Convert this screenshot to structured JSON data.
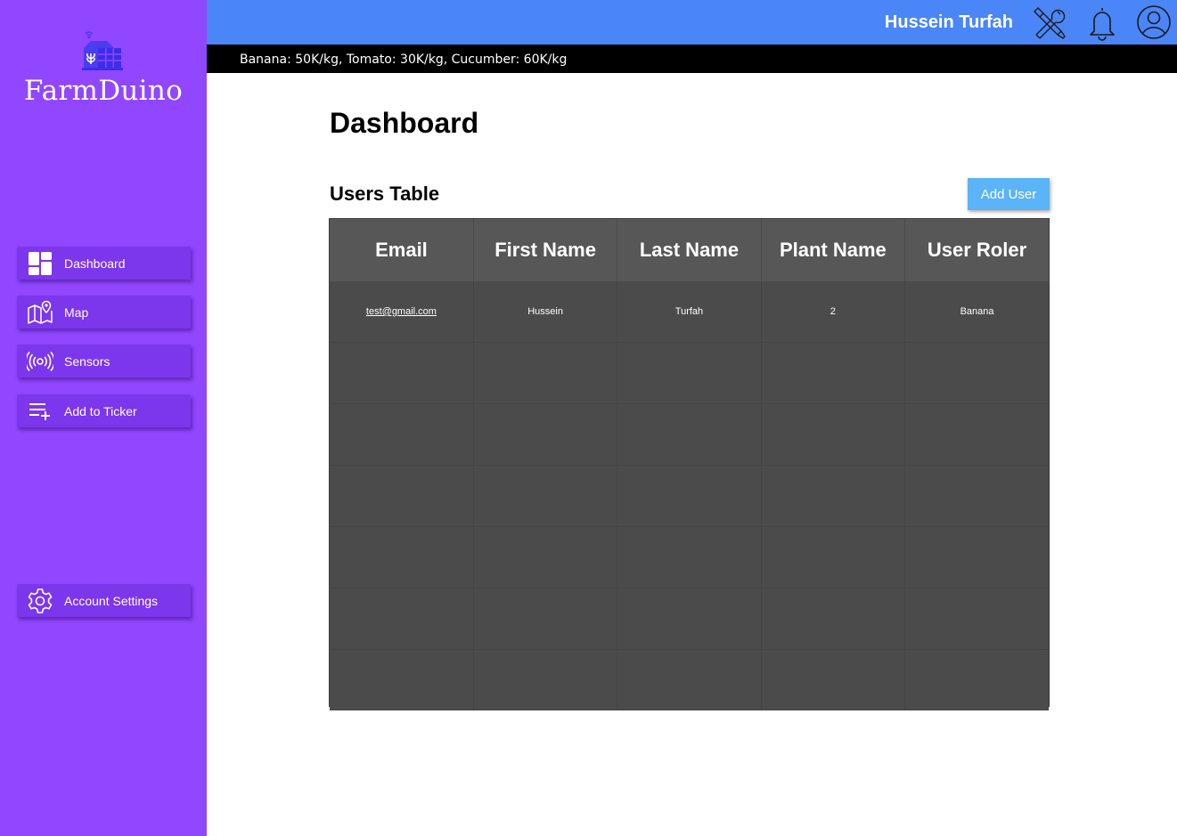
{
  "app": {
    "name": "FarmDuino"
  },
  "sidebar": {
    "items": [
      {
        "label": "Dashboard",
        "icon": "dashboard-icon"
      },
      {
        "label": "Map",
        "icon": "map-icon"
      },
      {
        "label": "Sensors",
        "icon": "sensor-icon"
      },
      {
        "label": "Add to Ticker",
        "icon": "playlist-add-icon"
      }
    ],
    "bottom_item": {
      "label": "Account Settings",
      "icon": "gear-icon"
    }
  },
  "header": {
    "username": "Hussein Turfah",
    "icons": [
      "tools-icon",
      "bell-icon",
      "user-avatar-icon"
    ]
  },
  "ticker": {
    "text": "Banana: 50K/kg, Tomato: 30K/kg, Cucumber: 60K/kg"
  },
  "main": {
    "title": "Dashboard",
    "section_title": "Users Table",
    "add_user_label": "Add User"
  },
  "table": {
    "columns": [
      "Email",
      "First Name",
      "Last Name",
      "Plant Name",
      "User Roler"
    ],
    "rows": [
      [
        "test@gmail.com",
        "Hussein",
        "Turfah",
        "2",
        "Banana"
      ],
      [
        "",
        "",
        "",
        "",
        ""
      ],
      [
        "",
        "",
        "",
        "",
        ""
      ],
      [
        "",
        "",
        "",
        "",
        ""
      ],
      [
        "",
        "",
        "",
        "",
        ""
      ],
      [
        "",
        "",
        "",
        "",
        ""
      ],
      [
        "",
        "",
        "",
        "",
        ""
      ]
    ]
  },
  "colors": {
    "sidebar": "#9146ff",
    "nav_item": "#7c36ec",
    "topbar": "#4a86f7",
    "ticker": "#000000",
    "add_user_button": "#5ab4f7",
    "table_header": "#575757",
    "table_body": "#4b4b4b"
  }
}
